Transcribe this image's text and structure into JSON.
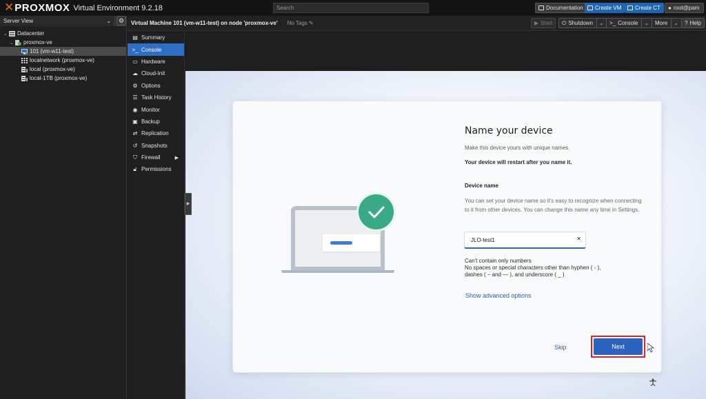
{
  "header": {
    "brand": "PROXMOX",
    "product": "Virtual Environment 9.2.18",
    "search_placeholder": "Search",
    "buttons": {
      "documentation": "Documentation",
      "create_vm": "Create VM",
      "create_ct": "Create CT",
      "user": "root@pam"
    }
  },
  "tree": {
    "view_label": "Server View",
    "items": [
      {
        "label": "Datacenter",
        "icon": "datacenter-icon"
      },
      {
        "label": "proxmox-ve",
        "icon": "node-icon"
      },
      {
        "label": "101 (vm-w11-test)",
        "icon": "vm-icon"
      },
      {
        "label": "localnetwork (proxmox-ve)",
        "icon": "network-icon"
      },
      {
        "label": "local (proxmox-ve)",
        "icon": "storage-icon"
      },
      {
        "label": "local-1TB (proxmox-ve)",
        "icon": "storage-icon"
      }
    ]
  },
  "vm_header": {
    "title": "Virtual Machine 101 (vm-w11-test) on node 'proxmox-ve'",
    "tags": "No Tags",
    "buttons": {
      "start": "Start",
      "shutdown": "Shutdown",
      "console": "Console",
      "more": "More",
      "help": "Help"
    }
  },
  "vm_menu": [
    {
      "label": "Summary",
      "icon": "summary-icon"
    },
    {
      "label": "Console",
      "icon": "console-icon"
    },
    {
      "label": "Hardware",
      "icon": "hardware-icon"
    },
    {
      "label": "Cloud-Init",
      "icon": "cloud-icon"
    },
    {
      "label": "Options",
      "icon": "gear-icon"
    },
    {
      "label": "Task History",
      "icon": "list-icon"
    },
    {
      "label": "Monitor",
      "icon": "eye-icon"
    },
    {
      "label": "Backup",
      "icon": "save-icon"
    },
    {
      "label": "Replication",
      "icon": "retweet-icon"
    },
    {
      "label": "Snapshots",
      "icon": "history-icon"
    },
    {
      "label": "Firewall",
      "icon": "shield-icon"
    },
    {
      "label": "Permissions",
      "icon": "unlock-icon"
    }
  ],
  "oobe": {
    "title": "Name your device",
    "subtitle": "Make this device yours with unique names.",
    "warning": "Your device will restart after you name it.",
    "field_label": "Device name",
    "help_text": "You can set your device name so it's easy to recognize when connecting to it from other devices. You can change this name any time in Settings.",
    "input_value": "JLO-test1",
    "rules": [
      "Can't contain only numbers",
      "No spaces or special characters other than hyphen ( - ),",
      "dashes ( – and — ), and underscore ( _ )"
    ],
    "advanced_link": "Show advanced options",
    "skip_label": "Skip",
    "next_label": "Next"
  },
  "colors": {
    "accent": "#2d6fc4",
    "proxmox_orange": "#e57000",
    "win_blue": "#2a64c0",
    "highlight_box": "#e0202a",
    "check_green": "#3aaa86"
  }
}
